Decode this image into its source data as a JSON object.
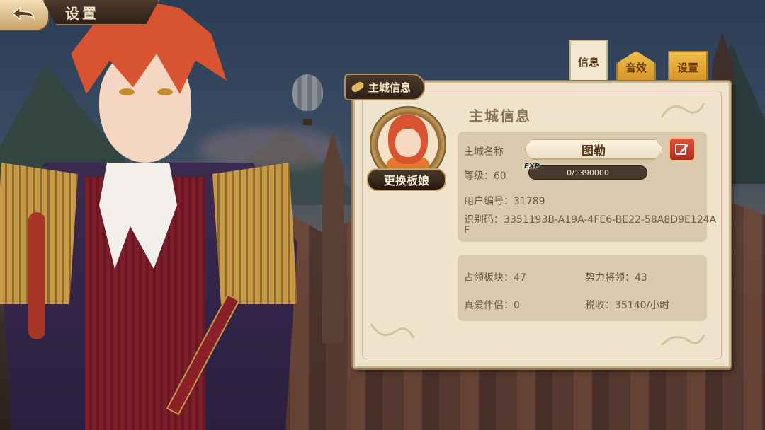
{
  "header": {
    "title": "设置"
  },
  "tabs": [
    {
      "label": "信息",
      "active": true
    },
    {
      "label": "音效",
      "active": false
    },
    {
      "label": "设置",
      "active": false
    }
  ],
  "panel": {
    "section_label": "主城信息",
    "heading": "主城信息",
    "change_button": "更换板娘",
    "city_name_label": "主城名称",
    "city_name": "图勒",
    "level_label": "等级：60",
    "exp_tag": "EXP",
    "exp_text": "0/1390000",
    "exp_progress": 0,
    "user_id_label": "用户编号：31789",
    "code_label_line1": "识别码：3351193B-A19A-4FE6-BE22-58A8D9E124A",
    "code_label_line2": "F",
    "stats": {
      "territory": "占领板块：47",
      "generals": "势力将领：43",
      "partner": "真爱伴侣：0",
      "tax": "税收：35140/小时"
    }
  },
  "colors": {
    "panel_bg": "#efe3cc",
    "tab_gold": "#e3a63a",
    "edit_red": "#c43a2a",
    "hair_red": "#d8532f"
  },
  "icons": [
    "back-arrow-icon",
    "pencil-edit-icon",
    "scroll-icon"
  ]
}
